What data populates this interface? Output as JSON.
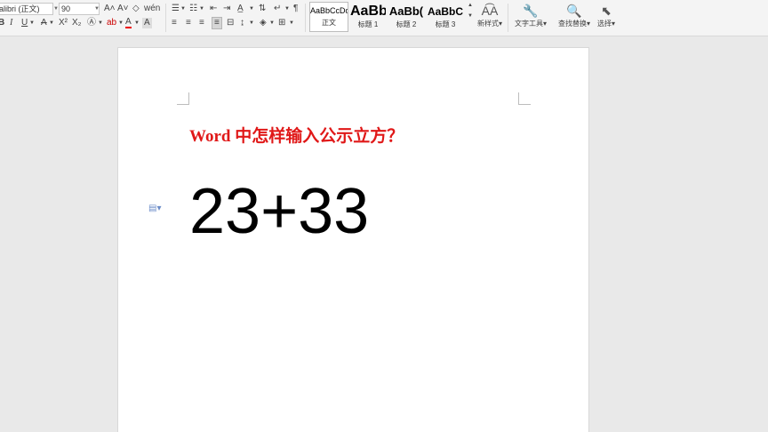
{
  "toolbar": {
    "font_name": "alibri (正文)",
    "font_size": "90",
    "row1_tools": [
      {
        "name": "grow-font-icon",
        "glyph": "A⁺"
      },
      {
        "name": "shrink-font-icon",
        "glyph": "A⁻"
      },
      {
        "name": "clear-format-icon",
        "glyph": "⌫"
      },
      {
        "name": "pinyin-icon",
        "glyph": "wén"
      },
      {
        "name": "bullet-list-icon",
        "glyph": "☰"
      },
      {
        "name": "numbered-list-icon",
        "glyph": "☷"
      },
      {
        "name": "decrease-indent-icon",
        "glyph": "⇤"
      },
      {
        "name": "increase-indent-icon",
        "glyph": "⇥"
      },
      {
        "name": "chinese-layout-icon",
        "glyph": "A̲"
      },
      {
        "name": "sort-icon",
        "glyph": "↕"
      },
      {
        "name": "show-marks-icon",
        "glyph": "¶"
      }
    ],
    "row2_tools": [
      {
        "name": "bold-icon",
        "glyph": "B"
      },
      {
        "name": "italic-icon",
        "glyph": "I"
      },
      {
        "name": "underline-icon",
        "glyph": "U"
      },
      {
        "name": "strikethrough-icon",
        "glyph": "A"
      },
      {
        "name": "superscript-icon",
        "glyph": "X²"
      },
      {
        "name": "subscript-icon",
        "glyph": "X₂"
      },
      {
        "name": "text-effect-icon",
        "glyph": "A"
      },
      {
        "name": "highlight-icon",
        "glyph": "ab"
      },
      {
        "name": "font-color-icon",
        "glyph": "A"
      },
      {
        "name": "char-shading-icon",
        "glyph": "A"
      },
      {
        "name": "align-left-icon",
        "glyph": "≡"
      },
      {
        "name": "align-center-icon",
        "glyph": "≡"
      },
      {
        "name": "align-right-icon",
        "glyph": "≡"
      },
      {
        "name": "justify-icon",
        "glyph": "≡"
      },
      {
        "name": "distribute-icon",
        "glyph": "⊟"
      },
      {
        "name": "line-spacing-icon",
        "glyph": "↨"
      },
      {
        "name": "shading-icon",
        "glyph": "◈"
      },
      {
        "name": "borders-icon",
        "glyph": "⊞"
      }
    ],
    "styles": [
      {
        "preview": "AaBbCcDd",
        "name": "正文"
      },
      {
        "preview": "AaBb",
        "name": "标题 1"
      },
      {
        "preview": "AaBb(",
        "name": "标题 2"
      },
      {
        "preview": "AaBbC",
        "name": "标题 3"
      }
    ],
    "new_style": "新样式",
    "text_tools": "文字工具",
    "find_replace": "查找替换",
    "select": "选择"
  },
  "document": {
    "title": "Word 中怎样输入公示立方？",
    "body": "23+33"
  },
  "colors": {
    "title_red": "#e01818",
    "page_bg": "#ffffff",
    "canvas_bg": "#e9e9e9"
  }
}
